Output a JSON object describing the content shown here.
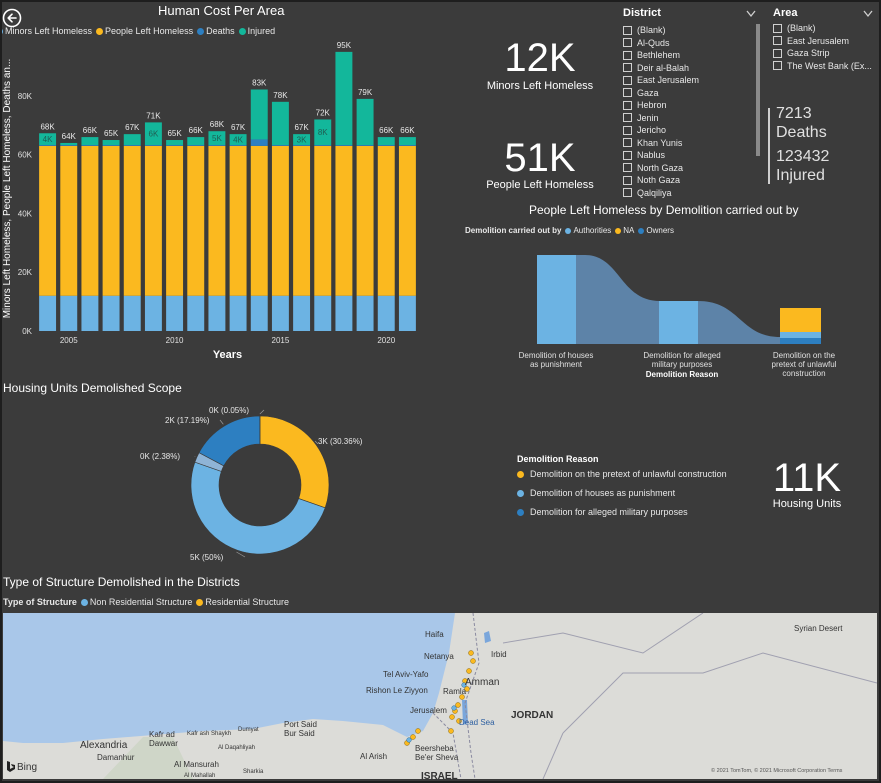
{
  "back_icon": "back-arrow-icon",
  "colors": {
    "background": "#3b3b3b",
    "minors": "#6cb3e3",
    "people": "#fbb91f",
    "deaths": "#2d7fc1",
    "injured": "#13b79b",
    "sea": "#a9c7e9",
    "land": "#dcdcd8"
  },
  "bar_chart": {
    "title": "Human Cost Per Area",
    "legend": [
      {
        "label": "Minors Left Homeless",
        "color": "#6cb3e3"
      },
      {
        "label": "People Left Homeless",
        "color": "#fbb91f"
      },
      {
        "label": "Deaths",
        "color": "#2d7fc1"
      },
      {
        "label": "Injured",
        "color": "#13b79b"
      }
    ],
    "ylabel": "Minors Left Homeless, People Left Homeless, Deaths an...",
    "xlabel": "Years"
  },
  "chart_data": {
    "type": "bar",
    "stacked": true,
    "title": "Human Cost Per Area",
    "xlabel": "Years",
    "ylabel": "Minors Left Homeless, People Left Homeless, Deaths an...",
    "x": [
      2004,
      2005,
      2006,
      2007,
      2008,
      2009,
      2010,
      2011,
      2012,
      2013,
      2014,
      2015,
      2016,
      2017,
      2018,
      2019,
      2020,
      2021
    ],
    "x_ticks": [
      "2005",
      "2010",
      "2015",
      "2020"
    ],
    "y_ticks": [
      "0K",
      "20K",
      "40K",
      "60K",
      "80K"
    ],
    "ylim": [
      0,
      97000
    ],
    "series": [
      {
        "name": "Minors Left Homeless",
        "values": [
          12000,
          12000,
          12000,
          12000,
          12000,
          12000,
          12000,
          12000,
          12000,
          12000,
          12000,
          12000,
          12000,
          12000,
          12000,
          12000,
          12000,
          12000
        ]
      },
      {
        "name": "People Left Homeless",
        "values": [
          51000,
          51000,
          51000,
          51000,
          51000,
          51000,
          51000,
          51000,
          51000,
          51000,
          51000,
          51000,
          51000,
          51000,
          51000,
          51000,
          51000,
          51000
        ]
      },
      {
        "name": "Deaths",
        "values": [
          300,
          300,
          300,
          300,
          300,
          300,
          300,
          300,
          300,
          300,
          2200,
          300,
          300,
          300,
          300,
          300,
          300,
          300
        ]
      },
      {
        "name": "Injured",
        "values": [
          4000,
          700,
          2700,
          1700,
          3700,
          7700,
          1700,
          2700,
          4700,
          3700,
          17000,
          14700,
          3700,
          8700,
          31700,
          15700,
          2700,
          2700
        ]
      }
    ],
    "totals": [
      68000,
      64000,
      66000,
      65000,
      67000,
      71000,
      65000,
      66000,
      68000,
      67000,
      83000,
      78000,
      67000,
      72000,
      95000,
      79000,
      66000,
      66000
    ],
    "total_labels": [
      "68K",
      "64K",
      "66K",
      "65K",
      "67K",
      "71K",
      "65K",
      "66K",
      "68K",
      "67K",
      "83K",
      "78K",
      "67K",
      "72K",
      "95K",
      "79K",
      "66K",
      "66K"
    ],
    "injured_labels": [
      "4K",
      "",
      "",
      "",
      "",
      "6K",
      "",
      "",
      "5K",
      "4K",
      "",
      "",
      "3K",
      "8K",
      "",
      "",
      "",
      ""
    ]
  },
  "kpis": {
    "minors": {
      "value": "12K",
      "label": "Minors Left Homeless"
    },
    "people": {
      "value": "51K",
      "label": "People Left Homeless"
    },
    "deaths": {
      "value": "7213",
      "label": "Deaths"
    },
    "injured": {
      "value": "123432",
      "label": "Injured"
    },
    "housing": {
      "value": "11K",
      "label": "Housing Units"
    }
  },
  "district_slicer": {
    "title": "District",
    "items": [
      "(Blank)",
      "Al-Quds",
      "Bethlehem",
      "Deir al-Balah",
      "East Jerusalem",
      "Gaza",
      "Hebron",
      "Jenin",
      "Jericho",
      "Khan Yunis",
      "Nablus",
      "North Gaza",
      "Noth Gaza",
      "Qalqiliya"
    ]
  },
  "area_slicer": {
    "title": "Area",
    "items": [
      "(Blank)",
      "East Jerusalem",
      "Gaza Strip",
      "The West Bank (Ex..."
    ]
  },
  "sankey": {
    "title": "People Left Homeless by Demolition carried out by",
    "legend_title": "Demolition carried out by",
    "legend": [
      {
        "label": "Authorities",
        "color": "#6cb3e3"
      },
      {
        "label": "NA",
        "color": "#fbb91f"
      },
      {
        "label": "Owners",
        "color": "#2d7fc1"
      }
    ],
    "axis_label": "Demolition Reason",
    "nodes": [
      "Demolition of houses as punishment",
      "Demolition for alleged military purposes",
      "Demolition on the pretext of unlawful construction"
    ]
  },
  "donut": {
    "title": "Housing Units Demolished Scope",
    "chart_data": {
      "type": "pie",
      "slices": [
        {
          "label": "3K (30.36%)",
          "value": 30.36,
          "color": "#fbb91f"
        },
        {
          "label": "5K (50%)",
          "value": 50.0,
          "color": "#6cb3e3"
        },
        {
          "label": "0K (2.38%)",
          "value": 2.38,
          "color": "#8fb4d6"
        },
        {
          "label": "2K (17.19%)",
          "value": 17.19,
          "color": "#2d7fc1"
        },
        {
          "label": "0K (0.05%)",
          "value": 0.05,
          "color": "#1a4f80"
        }
      ]
    }
  },
  "reason_legend": {
    "title": "Demolition Reason",
    "items": [
      {
        "label": "Demolition on the pretext of unlawful construction",
        "color": "#fbb91f"
      },
      {
        "label": "Demolition of houses as punishment",
        "color": "#6cb3e3"
      },
      {
        "label": "Demolition for alleged military purposes",
        "color": "#2d7fc1"
      }
    ]
  },
  "map": {
    "title": "Type of Structure Demolished in the Districts",
    "legend_title": "Type of Structure",
    "legend": [
      {
        "label": "Non Residential Structure",
        "color": "#6cb3e3"
      },
      {
        "label": "Residential Structure",
        "color": "#fbb91f"
      }
    ],
    "places": [
      "Haifa",
      "Netanya",
      "Irbid",
      "Tel Aviv-Yafo",
      "Amman",
      "Rishon Le Ziyyon",
      "Ramla",
      "Jerusalem",
      "Dead Sea",
      "JORDAN",
      "Beersheba Be'er Sheva",
      "ISRAEL",
      "Port Said Bur Said",
      "Alexandria",
      "Kafr ad Dawwar",
      "Damanhur",
      "Al Mansurah",
      "Al Arish",
      "Syrian Desert",
      "Kafr ash Shaykh",
      "Al Daqahliyah",
      "Dumyat",
      "Sharkia",
      "Al Mahallah"
    ],
    "bing": "Bing",
    "copyright": "© 2021 TomTom, © 2021 Microsoft Corporation Terms"
  }
}
